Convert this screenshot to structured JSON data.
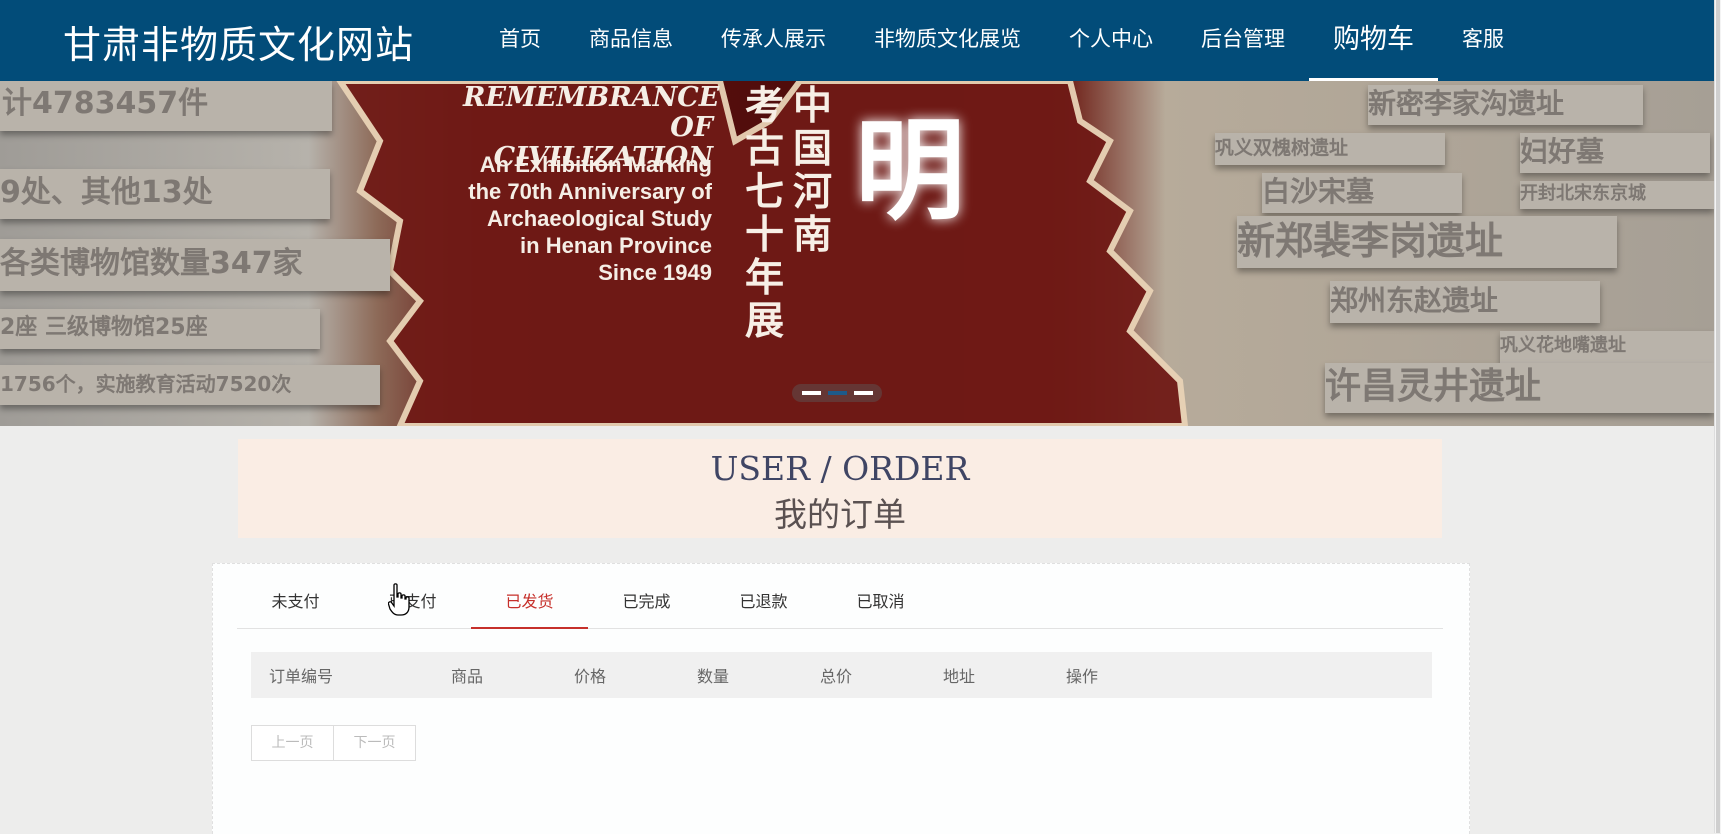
{
  "header": {
    "site_title": "甘肃非物质文化网站",
    "nav": [
      {
        "label": "首页",
        "active": false
      },
      {
        "label": "商品信息",
        "active": false
      },
      {
        "label": "传承人展示",
        "active": false
      },
      {
        "label": "非物质文化展览",
        "active": false
      },
      {
        "label": "个人中心",
        "active": false
      },
      {
        "label": "后台管理",
        "active": false
      },
      {
        "label": "购物车",
        "active": true
      },
      {
        "label": "客服",
        "active": false
      }
    ],
    "background_color": "#024c79"
  },
  "banner": {
    "title_en": "REMEMBRANCE OF CIVILIZATION",
    "subtitle_en": "An Exhibition Marking the 70th Anniversary of Archaeological Study in Henan Province Since 1949",
    "cn_col1": "中国河南",
    "cn_col2": "考古七十年展",
    "big_char": "明",
    "plaques": [
      "新密李家沟遗址",
      "巩义双槐树遗址",
      "妇好墓",
      "白沙宋墓",
      "开封北宋东京城",
      "新郑裴李岗遗址",
      "郑州东赵遗址",
      "巩义花地嘴遗址",
      "许昌灵井遗址",
      "计4783457件",
      "9处、其他13处",
      "各类博物馆数量347家",
      "2座 三级博物馆25座",
      "1756个，实施教育活动7520次"
    ],
    "slides_total": 3,
    "slide_active": 2
  },
  "page_heading": {
    "en": "USER / ORDER",
    "cn": "我的订单"
  },
  "order_tabs": [
    {
      "label": "未支付",
      "active": false
    },
    {
      "label": "已支付",
      "active": false
    },
    {
      "label": "已发货",
      "active": true
    },
    {
      "label": "已完成",
      "active": false
    },
    {
      "label": "已退款",
      "active": false
    },
    {
      "label": "已取消",
      "active": false
    }
  ],
  "table": {
    "columns": [
      "订单编号",
      "商品",
      "价格",
      "数量",
      "总价",
      "地址",
      "操作"
    ],
    "rows": []
  },
  "pagination": {
    "prev_label": "上一页",
    "next_label": "下一页"
  },
  "colors": {
    "accent_red": "#c6302b",
    "heading_bg": "#faede4"
  }
}
